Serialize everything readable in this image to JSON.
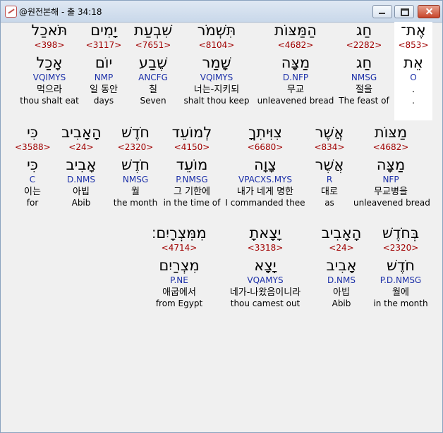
{
  "window": {
    "title": "@원전본해 - 출 34:18",
    "min_label": "",
    "max_label": "",
    "close_label": ""
  },
  "rows": [
    {
      "words": [
        {
          "heb": "אֶת־",
          "strong": "<853>",
          "lemma": "אֵת",
          "morph": "O",
          "ko": ".",
          "en": "."
        },
        {
          "heb": "חַג",
          "strong": "<2282>",
          "lemma": "חַג",
          "morph": "NMSG",
          "ko": "절을",
          "en": "The feast of"
        },
        {
          "heb": "הַמַּצּוֹת",
          "strong": "<4682>",
          "lemma": "מַצָּה",
          "morph": "D.NFP",
          "ko": "무교",
          "en": "unleavened bread"
        },
        {
          "heb": "תִּשְׁמֹר",
          "strong": "<8104>",
          "lemma": "שָׁמַר",
          "morph": "VQIMYS",
          "ko": "너는-지키되",
          "en": "shalt thou keep"
        },
        {
          "heb": "שִׁבְעַת",
          "strong": "<7651>",
          "lemma": "שֶׁבַע",
          "morph": "ANCFG",
          "ko": "칠",
          "en": "Seven"
        },
        {
          "heb": "יָמִים",
          "strong": "<3117>",
          "lemma": "יוֹם",
          "morph": "NMP",
          "ko": "일 동안",
          "en": "days"
        },
        {
          "heb": "תֹּאכַל",
          "strong": "<398>",
          "lemma": "אָכַל",
          "morph": "VQIMYS",
          "ko": "먹으라",
          "en": "thou shalt eat"
        }
      ]
    },
    {
      "words": [
        {
          "heb": "מַצּוֹת",
          "strong": "<4682>",
          "lemma": "מַצָּה",
          "morph": "NFP",
          "ko": "무교병을",
          "en": "unleavened bread"
        },
        {
          "heb": "אֲשֶׁר",
          "strong": "<834>",
          "lemma": "אֲשֶׁר",
          "morph": "R",
          "ko": "대로",
          "en": "as"
        },
        {
          "heb": "צִוִּיתִךָ",
          "strong": "<6680>",
          "lemma": "צָוָה",
          "morph": "VPACXS.MYS",
          "ko": "내가 네게 명한",
          "en": "I commanded thee"
        },
        {
          "heb": "לְמוֹעֵד",
          "strong": "<4150>",
          "lemma": "מוֹעֵד",
          "morph": "P.NMSG",
          "ko": "그 기한에",
          "en": "in the time of"
        },
        {
          "heb": "חֹדֶשׁ",
          "strong": "<2320>",
          "lemma": "חֹדֶשׁ",
          "morph": "NMSG",
          "ko": "월",
          "en": "the month"
        },
        {
          "heb": "הָאָבִיב",
          "strong": "<24>",
          "lemma": "אָבִיב",
          "morph": "D.NMS",
          "ko": "아빕",
          "en": "Abib"
        },
        {
          "heb": "כִּי",
          "strong": "<3588>",
          "lemma": "כִּי",
          "morph": "C",
          "ko": "이는",
          "en": "for"
        }
      ]
    },
    {
      "words": [
        {
          "heb": "בְּחֹדֶשׁ",
          "strong": "<2320>",
          "lemma": "חֹדֶשׁ",
          "morph": "P.D.NMSG",
          "ko": "월에",
          "en": "in the month"
        },
        {
          "heb": "הָאָבִיב",
          "strong": "<24>",
          "lemma": "אָבִיב",
          "morph": "D.NMS",
          "ko": "아빕",
          "en": "Abib"
        },
        {
          "heb": "יָצָאתָ",
          "strong": "<3318>",
          "lemma": "יָצָא",
          "morph": "VQAMYS",
          "ko": "네가-나왔음이니라",
          "en": "thou camest out"
        },
        {
          "heb": "מִמִּצְרָיִם׃",
          "strong": "<4714>",
          "lemma": "מִצְרַיִם",
          "morph": "P.NE",
          "ko": "애굽에서",
          "en": "from Egypt"
        }
      ]
    }
  ]
}
